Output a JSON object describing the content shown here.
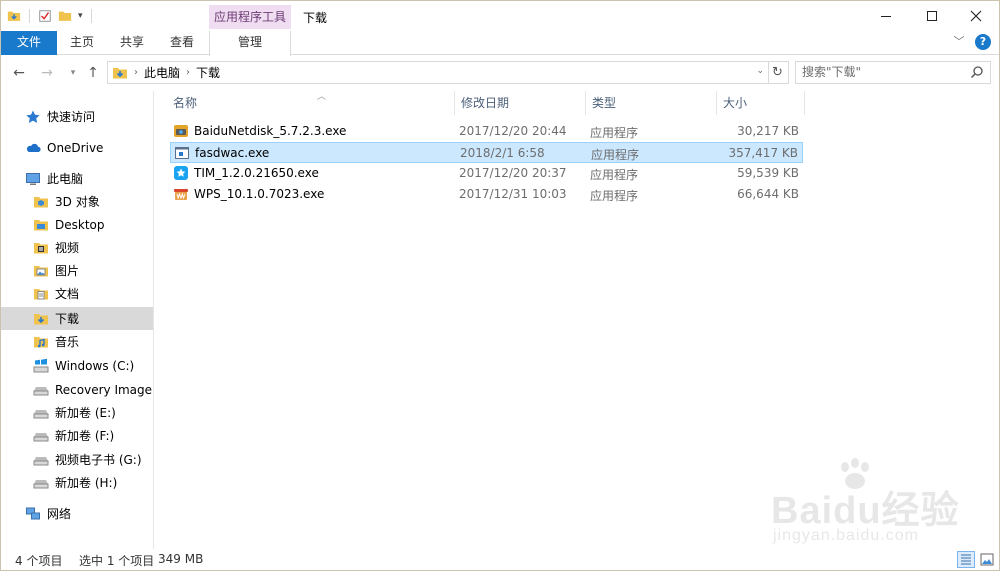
{
  "window": {
    "title": "下载",
    "context_tab_group": "应用程序工具"
  },
  "ribbon": {
    "tabs": [
      {
        "label": "文件"
      },
      {
        "label": "主页"
      },
      {
        "label": "共享"
      },
      {
        "label": "查看"
      },
      {
        "label": "管理"
      }
    ],
    "help_label": "?"
  },
  "address": {
    "crumbs": [
      "此电脑",
      "下载"
    ],
    "search_placeholder": "搜索\"下载\""
  },
  "sidebar": {
    "items": [
      {
        "label": "快速访问",
        "icon": "star-icon"
      },
      {
        "label": "OneDrive",
        "icon": "cloud-icon"
      },
      {
        "label": "此电脑",
        "icon": "computer-icon"
      },
      {
        "label": "3D 对象",
        "icon": "folder-3d-icon"
      },
      {
        "label": "Desktop",
        "icon": "folder-desktop-icon"
      },
      {
        "label": "视频",
        "icon": "folder-video-icon"
      },
      {
        "label": "图片",
        "icon": "folder-pictures-icon"
      },
      {
        "label": "文档",
        "icon": "folder-documents-icon"
      },
      {
        "label": "下载",
        "icon": "folder-downloads-icon",
        "selected": true
      },
      {
        "label": "音乐",
        "icon": "folder-music-icon"
      },
      {
        "label": "Windows (C:)",
        "icon": "drive-windows-icon"
      },
      {
        "label": "Recovery Image (I",
        "icon": "drive-icon"
      },
      {
        "label": "新加卷 (E:)",
        "icon": "drive-icon"
      },
      {
        "label": "新加卷 (F:)",
        "icon": "drive-icon"
      },
      {
        "label": "视频电子书 (G:)",
        "icon": "drive-icon"
      },
      {
        "label": "新加卷 (H:)",
        "icon": "drive-icon"
      },
      {
        "label": "网络",
        "icon": "network-icon"
      }
    ]
  },
  "columns": {
    "name": "名称",
    "date": "修改日期",
    "type": "类型",
    "size": "大小"
  },
  "files": [
    {
      "name": "BaiduNetdisk_5.7.2.3.exe",
      "date": "2017/12/20 20:44",
      "type": "应用程序",
      "size": "30,217 KB",
      "icon": "baidu-netdisk-icon"
    },
    {
      "name": "fasdwac.exe",
      "date": "2018/2/1 6:58",
      "type": "应用程序",
      "size": "357,417 KB",
      "icon": "generic-exe-icon",
      "selected": true
    },
    {
      "name": "TIM_1.2.0.21650.exe",
      "date": "2017/12/20 20:37",
      "type": "应用程序",
      "size": "59,539 KB",
      "icon": "tim-icon"
    },
    {
      "name": "WPS_10.1.0.7023.exe",
      "date": "2017/12/31 10:03",
      "type": "应用程序",
      "size": "66,644 KB",
      "icon": "wps-icon"
    }
  ],
  "status": {
    "count": "4 个项目",
    "selected": "选中 1 个项目",
    "size": "349 MB"
  },
  "watermark": {
    "logo_text": "Baidu经验",
    "url": "jingyan.baidu.com"
  },
  "colors": {
    "accent": "#1979ca",
    "context_tab": "#f1ddf2",
    "selection": "#cce8ff",
    "selection_border": "#99d1ff",
    "header_text": "#4c607a"
  }
}
